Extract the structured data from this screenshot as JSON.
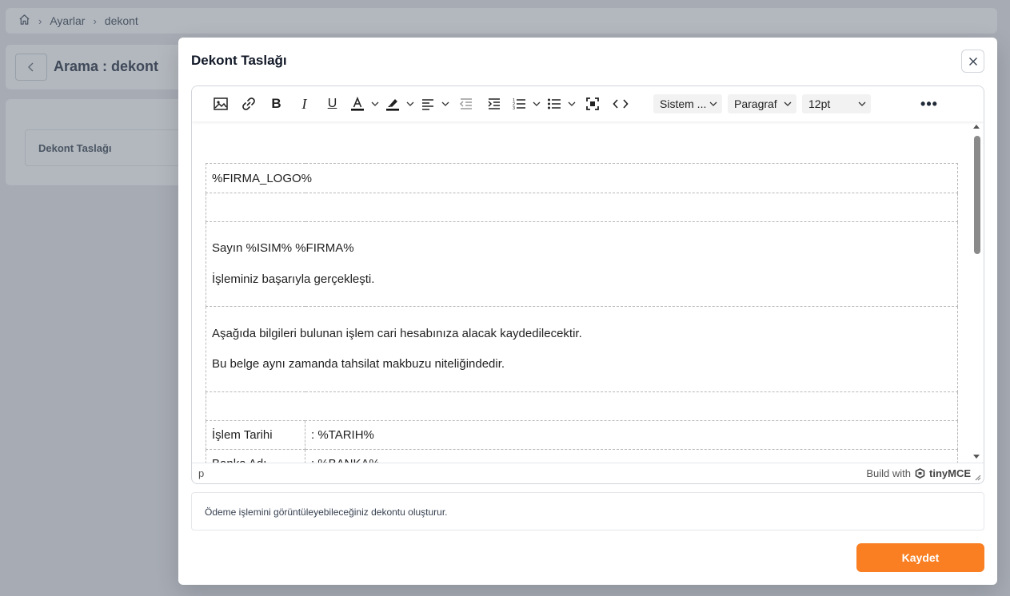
{
  "breadcrumb": {
    "items": [
      "Ayarlar",
      "dekont"
    ]
  },
  "search": {
    "title": "Arama : dekont"
  },
  "list": {
    "items": [
      {
        "label": "Dekont Taslağı"
      }
    ]
  },
  "modal": {
    "title": "Dekont Taslağı",
    "close_icon": "close-icon",
    "toolbar": {
      "icons": [
        "image-icon",
        "link-icon",
        "bold-icon",
        "italic-icon",
        "underline-icon",
        "text-color-icon",
        "highlight-icon",
        "align-icon",
        "outdent-icon",
        "indent-icon",
        "numbered-list-icon",
        "bullet-list-icon",
        "fullscreen-icon",
        "source-code-icon",
        "more-icon"
      ],
      "font_family": "Sistem ...",
      "block_format": "Paragraf",
      "font_size": "12pt"
    },
    "document": {
      "logo_placeholder": "%FIRMA_LOGO%",
      "greeting": "Sayın %ISIM% %FIRMA%",
      "success": "İşleminiz başarıyla gerçekleşti.",
      "info_line1": "Aşağıda bilgileri bulunan işlem cari hesabınıza alacak kaydedilecektir.",
      "info_line2": "Bu belge aynı zamanda tahsilat makbuzu niteliğindedir.",
      "rows": [
        {
          "label": "İşlem Tarihi",
          "value": ": %TARIH%"
        },
        {
          "label": "Banka Adı",
          "value": ": %BANKA%"
        }
      ]
    },
    "statusbar": {
      "path": "p",
      "brand_prefix": "Build with",
      "brand_name": "tinyMCE"
    },
    "description": "Ödeme işlemini görüntüleyebileceğiniz dekontu oluşturur.",
    "save_label": "Kaydet"
  },
  "colors": {
    "accent": "#f97f22",
    "overlay": "#4b5563"
  }
}
